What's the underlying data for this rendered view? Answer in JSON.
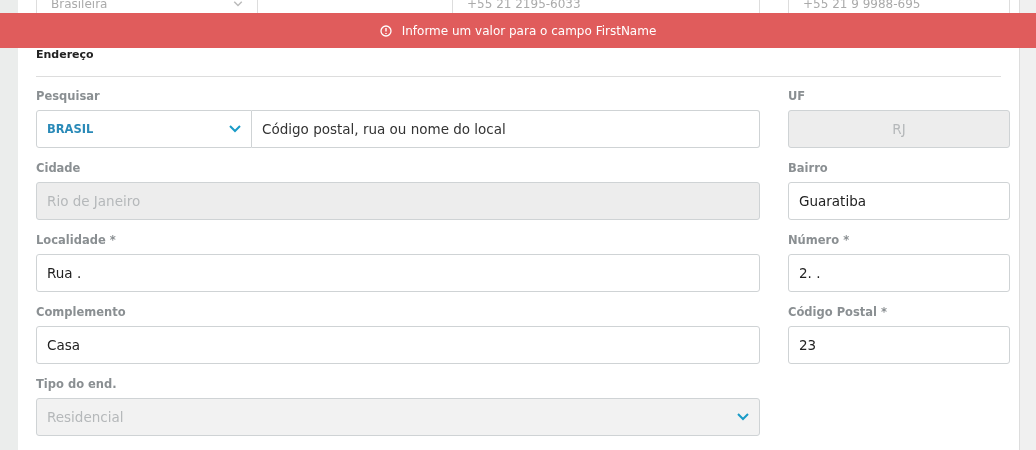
{
  "toast": {
    "message": "Informe um valor para o campo FirstName"
  },
  "top_row": [
    {
      "kind": "select",
      "value": "Brasileira"
    },
    {
      "kind": "text",
      "value": "+55 21 2195-6033"
    },
    {
      "kind": "text",
      "value": "+55 21 9 9988-695"
    }
  ],
  "section": {
    "title": "Endereço"
  },
  "rows": [
    {
      "left": {
        "label": "Pesquisar",
        "kind": "search",
        "country": "BRASIL",
        "placeholder": "Código postal, rua ou nome do local",
        "disabled": false
      },
      "right": {
        "label": "UF",
        "kind": "text",
        "value": "RJ",
        "disabled": true
      }
    },
    {
      "left": {
        "label": "Cidade",
        "kind": "text",
        "value": "Rio de Janeiro",
        "disabled": true
      },
      "right": {
        "label": "Bairro",
        "kind": "text",
        "value": "Guaratiba",
        "disabled": false
      }
    },
    {
      "left": {
        "label": "Localidade *",
        "kind": "text",
        "value": "Rua .",
        "disabled": false
      },
      "right": {
        "label": "Número *",
        "kind": "text",
        "value": "2. .",
        "disabled": false
      }
    },
    {
      "left": {
        "label": "Complemento",
        "kind": "text",
        "value": "Casa",
        "disabled": false
      },
      "right": {
        "label": "Código Postal *",
        "kind": "text",
        "value": "23",
        "disabled": false
      }
    },
    {
      "left": {
        "label": "Tipo do end.",
        "kind": "select",
        "value": "Residencial",
        "disabled": true
      }
    }
  ]
}
